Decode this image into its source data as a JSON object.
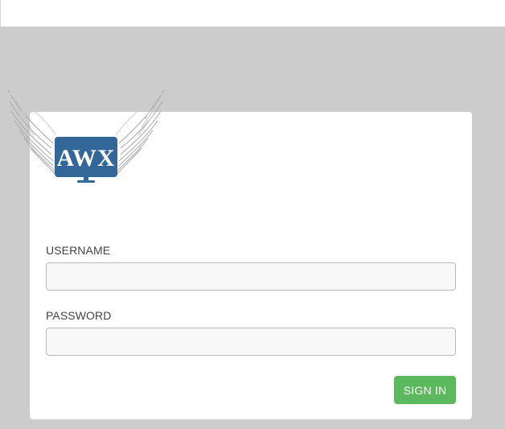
{
  "brand": {
    "logo_text": "AWX",
    "color": "#336699"
  },
  "login": {
    "username_label": "USERNAME",
    "username_value": "",
    "password_label": "PASSWORD",
    "password_value": "",
    "signin_label": "SIGN IN"
  },
  "colors": {
    "background": "#cccccc",
    "card": "#ffffff",
    "signin": "#5cb85c"
  }
}
